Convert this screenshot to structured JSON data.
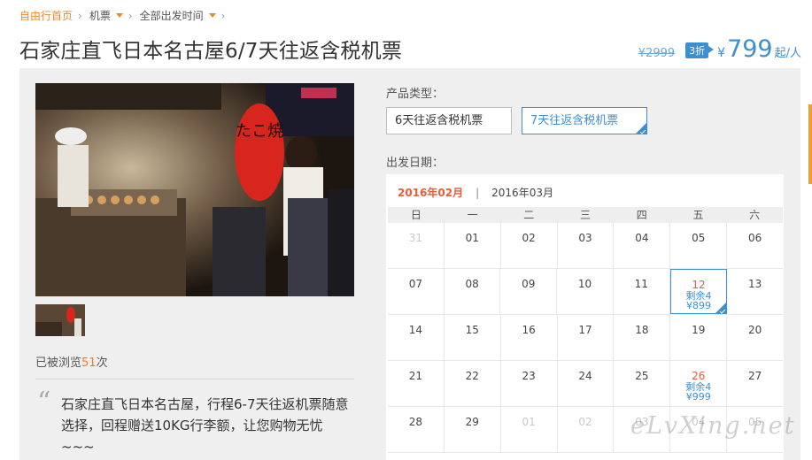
{
  "breadcrumb": {
    "home": "自由行首页",
    "item1": "机票",
    "item2": "全部出发时间"
  },
  "product": {
    "title": "石家庄直飞日本名古屋6/7天往返含税机票",
    "old_price": "¥2999",
    "discount": "3折",
    "currency": "¥",
    "price": "799",
    "per": "起/人"
  },
  "gallery": {
    "views_prefix": "已被浏览",
    "views_count": "51",
    "views_suffix": "次",
    "lantern_text": "たこ焼"
  },
  "description": "石家庄直飞日本名古屋，行程6-7天往返机票随意选择，回程赠送10KG行李额，让您购物无忧~~~",
  "type_label": "产品类型：",
  "types": [
    "6天往返含税机票",
    "7天往返含税机票"
  ],
  "selected_type_index": 1,
  "date_label": "出发日期：",
  "calendar": {
    "months": [
      "2016年02月",
      "2016年03月"
    ],
    "month_separator": "|",
    "weekdays": [
      "日",
      "一",
      "二",
      "三",
      "四",
      "五",
      "六"
    ],
    "rows": [
      [
        {
          "d": "31",
          "m": true
        },
        {
          "d": "01"
        },
        {
          "d": "02"
        },
        {
          "d": "03"
        },
        {
          "d": "04"
        },
        {
          "d": "05"
        },
        {
          "d": "06"
        }
      ],
      [
        {
          "d": "07"
        },
        {
          "d": "08"
        },
        {
          "d": "09"
        },
        {
          "d": "10"
        },
        {
          "d": "11"
        },
        {
          "d": "12",
          "rem": "剩余4",
          "pr": "¥899",
          "sel": true
        },
        {
          "d": "13"
        }
      ],
      [
        {
          "d": "14"
        },
        {
          "d": "15"
        },
        {
          "d": "16"
        },
        {
          "d": "17"
        },
        {
          "d": "18"
        },
        {
          "d": "19"
        },
        {
          "d": "20"
        }
      ],
      [
        {
          "d": "21"
        },
        {
          "d": "22"
        },
        {
          "d": "23"
        },
        {
          "d": "24"
        },
        {
          "d": "25"
        },
        {
          "d": "26",
          "rem": "剩余4",
          "pr": "¥999"
        },
        {
          "d": "27"
        }
      ],
      [
        {
          "d": "28"
        },
        {
          "d": "29"
        },
        {
          "d": "01",
          "m": true
        },
        {
          "d": "02",
          "m": true
        },
        {
          "d": "03",
          "m": true
        },
        {
          "d": "04",
          "m": true
        },
        {
          "d": "05",
          "m": true
        }
      ]
    ]
  },
  "watermark": "eLvXing.net",
  "colors": {
    "accent_blue": "#3d8fd1",
    "accent_orange": "#e8892b",
    "highlight_red": "#e85c3a"
  }
}
